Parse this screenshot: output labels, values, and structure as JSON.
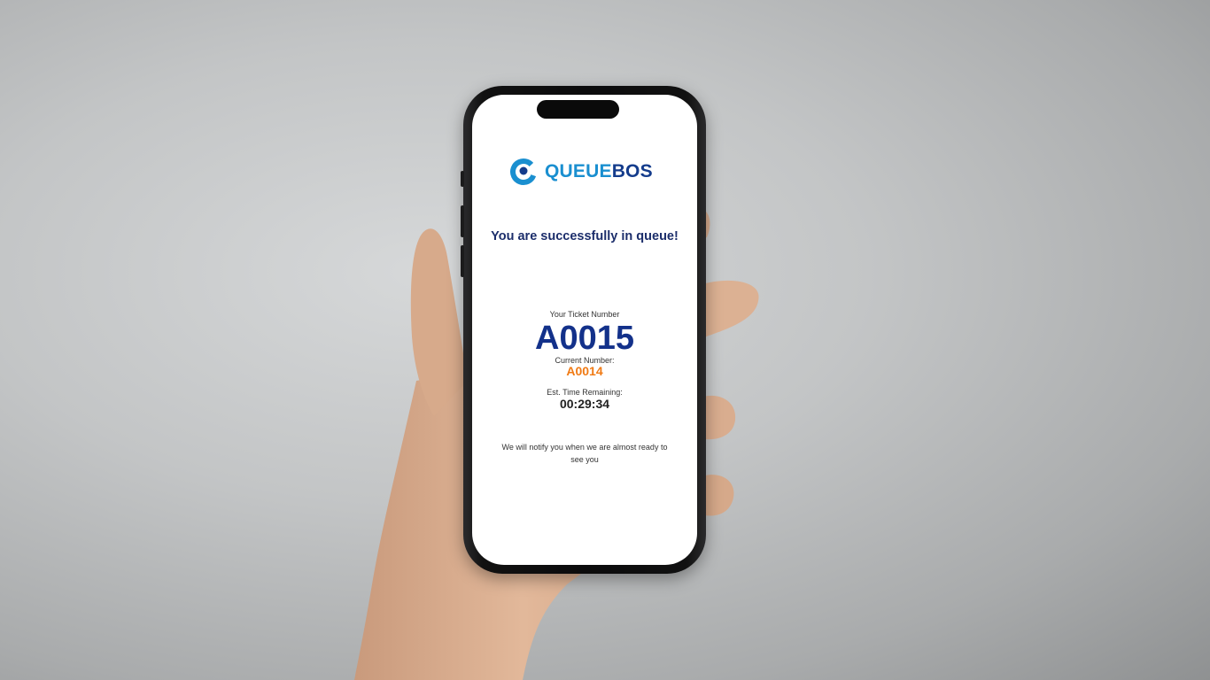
{
  "brand": {
    "name_part1": "QUEUE",
    "name_part2": "BOS",
    "primary_color": "#1a8fd0",
    "secondary_color": "#143c8c"
  },
  "screen": {
    "headline": "You are successfully in queue!",
    "ticket_label": "Your Ticket Number",
    "ticket_number": "A0015",
    "current_label": "Current Number:",
    "current_number": "A0014",
    "time_label": "Est. Time Remaining:",
    "time_remaining": "00:29:34",
    "notify_message": "We will notify you when we are almost ready to see you"
  },
  "colors": {
    "ticket_number": "#13318a",
    "current_number": "#f07a14",
    "headline": "#1c2e6b"
  }
}
